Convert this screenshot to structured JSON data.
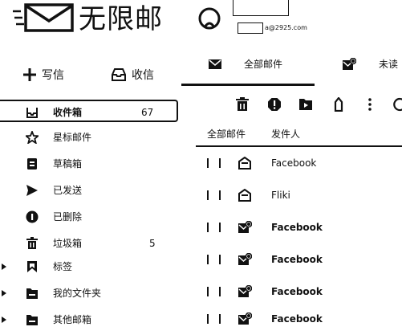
{
  "header": {
    "app_title": "无限邮",
    "account_email": "a@2925.com"
  },
  "actions": {
    "compose_label": "写信",
    "receive_label": "收信"
  },
  "tabs": [
    {
      "label": "全部邮件",
      "active": true
    },
    {
      "label": "未读",
      "active": false
    }
  ],
  "sidebar": {
    "items": [
      {
        "label": "收件箱",
        "count": "67",
        "icon": "inbox-icon",
        "active": true
      },
      {
        "label": "星标邮件",
        "count": "",
        "icon": "star-icon"
      },
      {
        "label": "草稿箱",
        "count": "",
        "icon": "draft-icon"
      },
      {
        "label": "已发送",
        "count": "",
        "icon": "send-icon"
      },
      {
        "label": "已删除",
        "count": "",
        "icon": "deleted-icon"
      },
      {
        "label": "垃圾箱",
        "count": "5",
        "icon": "trash-icon"
      },
      {
        "label": "标签",
        "count": "",
        "icon": "bookmark-icon",
        "expandable": true
      },
      {
        "label": "我的文件夹",
        "count": "",
        "icon": "folder-icon",
        "expandable": true
      },
      {
        "label": "其他邮箱",
        "count": "",
        "icon": "other-mailbox-icon",
        "expandable": true
      }
    ]
  },
  "toolbar": {
    "icons": [
      "delete-icon",
      "spam-icon",
      "move-to-folder-icon",
      "tag-icon",
      "more-icon",
      "refresh-icon"
    ]
  },
  "table": {
    "columns": [
      "全部邮件",
      "发件人"
    ],
    "rows": [
      {
        "sender": "Facebook",
        "read": true,
        "icon": "opened-mail-icon"
      },
      {
        "sender": "Fliki",
        "read": true,
        "icon": "opened-mail-icon"
      },
      {
        "sender": "Facebook",
        "read": false,
        "icon": "unread-mail-icon"
      },
      {
        "sender": "Facebook",
        "read": false,
        "icon": "unread-mail-icon"
      },
      {
        "sender": "Facebook",
        "read": false,
        "icon": "unread-mail-icon"
      },
      {
        "sender": "Facebook",
        "read": false,
        "icon": "unread-mail-icon"
      }
    ]
  }
}
